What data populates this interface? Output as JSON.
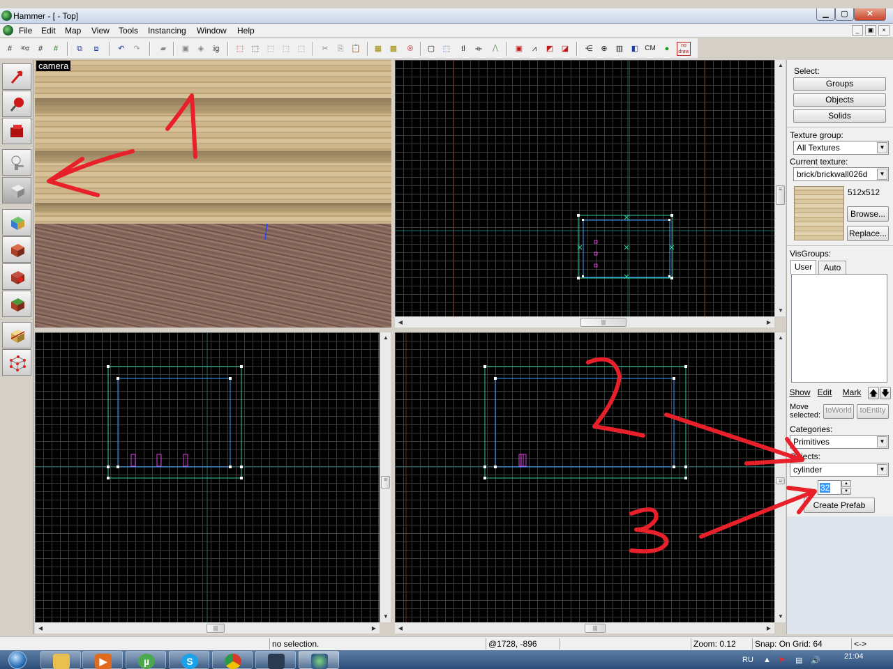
{
  "window": {
    "title": "Hammer - [ - Top]",
    "minimize_glyph": "▁",
    "maximize_glyph": "▢",
    "close_glyph": "✕"
  },
  "menu": {
    "items": [
      "File",
      "Edit",
      "Map",
      "View",
      "Tools",
      "Instancing",
      "Window",
      "Help"
    ],
    "mdi_min": "_",
    "mdi_restore": "▣",
    "mdi_close": "×"
  },
  "toolbar": {
    "text_buttons": {
      "cm": "CM",
      "no_draw": "no draw"
    }
  },
  "tools": [
    {
      "name": "selection-tool",
      "icon": "arrow-pointer-icon"
    },
    {
      "name": "magnify-tool",
      "icon": "magnify-icon"
    },
    {
      "name": "camera-tool",
      "icon": "camera-icon"
    },
    {
      "name": "entity-tool",
      "icon": "entity-icon"
    },
    {
      "name": "block-tool",
      "icon": "block-icon"
    },
    {
      "name": "texture-application-tool",
      "icon": "texture-app-icon"
    },
    {
      "name": "apply-current-texture-tool",
      "icon": "apply-texture-icon"
    },
    {
      "name": "decal-tool",
      "icon": "decal-icon"
    },
    {
      "name": "overlay-tool",
      "icon": "overlay-icon"
    },
    {
      "name": "clipping-tool",
      "icon": "clipping-icon"
    },
    {
      "name": "vertex-tool",
      "icon": "vertex-icon"
    }
  ],
  "camera_view": {
    "label": "camera"
  },
  "right_panel": {
    "select_label": "Select:",
    "buttons": [
      "Groups",
      "Objects",
      "Solids"
    ],
    "texture_group_label": "Texture group:",
    "texture_group_value": "All Textures",
    "current_texture_label": "Current texture:",
    "current_texture_value": "brick/brickwall026d",
    "texture_size": "512x512",
    "browse_label": "Browse...",
    "replace_label": "Replace...",
    "visgroups_label": "VisGroups:",
    "tabs": [
      "User",
      "Auto"
    ],
    "vis_buttons": [
      "Show",
      "Edit",
      "Mark"
    ],
    "up_arrow": "🡅",
    "down_arrow": "🡇",
    "move_selected_label": "Move selected:",
    "to_world_label": "toWorld",
    "to_entity_label": "toEntity",
    "categories_label": "Categories:",
    "categories_value": "Primitives",
    "objects_label": "Objects:",
    "objects_value": "cylinder",
    "sides_value": "32",
    "create_prefab_label": "Create Prefab"
  },
  "status": {
    "selection": "no selection.",
    "coords": "@1728, -896",
    "zoom": "Zoom: 0.12",
    "snap": "Snap: On Grid: 64",
    "extra": "<->"
  },
  "annotations": {
    "one": "1",
    "two": "2",
    "three": "3"
  },
  "taskbar": {
    "apps": [
      {
        "name": "explorer",
        "icon": "folder-icon"
      },
      {
        "name": "media-player",
        "icon": "media-player-icon"
      },
      {
        "name": "utorrent",
        "icon": "utorrent-icon",
        "glyph": "µ"
      },
      {
        "name": "skype",
        "icon": "skype-icon",
        "glyph": "S"
      },
      {
        "name": "chrome",
        "icon": "chrome-icon"
      },
      {
        "name": "steam",
        "icon": "steam-icon"
      },
      {
        "name": "hammer",
        "icon": "hammer-icon"
      }
    ],
    "language": "RU",
    "clock": "21:04"
  },
  "colors": {
    "annotation_red": "#e8202a",
    "selection_box": "#2fd1a0",
    "brush_outline": "#3aa0ff",
    "prefab_pink": "#e040e0"
  }
}
